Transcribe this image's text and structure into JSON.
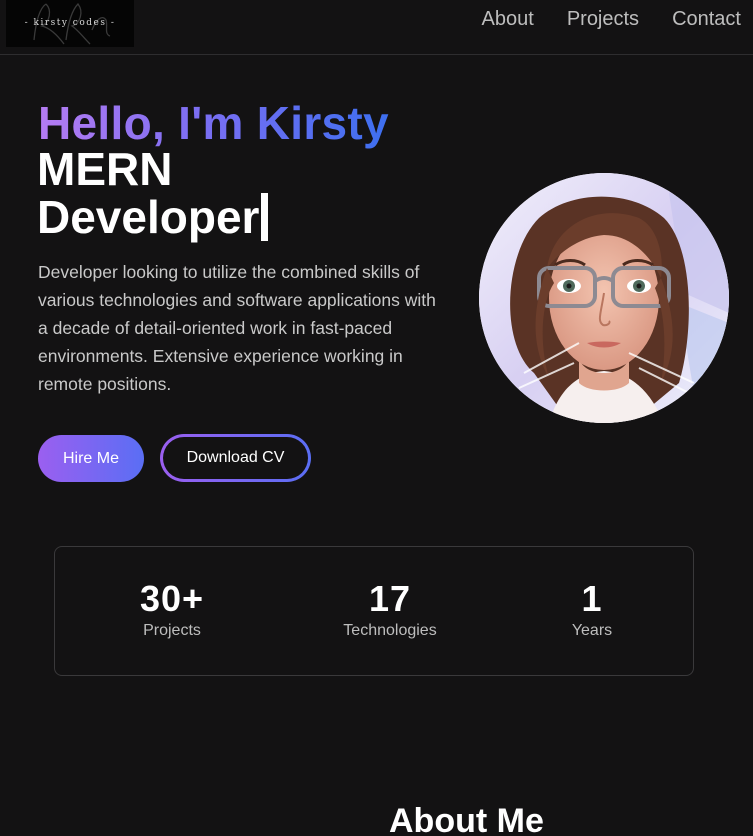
{
  "header": {
    "logo_text": "- kirsty codes -",
    "nav": [
      "About",
      "Projects",
      "Contact"
    ]
  },
  "hero": {
    "greeting": "Hello, I'm Kirsty",
    "role_line1": "MERN",
    "role_line2": "Developer",
    "bio": "Developer looking to utilize the combined skills of various technologies and software applications with a decade of detail-oriented work in fast-paced environments. Extensive experience working in remote positions.",
    "hire_label": "Hire Me",
    "cv_label": "Download CV"
  },
  "stats": [
    {
      "value": "30+",
      "label": "Projects"
    },
    {
      "value": "17",
      "label": "Technologies"
    },
    {
      "value": "1",
      "label": "Years"
    }
  ],
  "about": {
    "title": "About Me"
  },
  "colors": {
    "background": "#131213",
    "gradient_start": "#b57cf2",
    "gradient_end": "#3d6ff0"
  }
}
